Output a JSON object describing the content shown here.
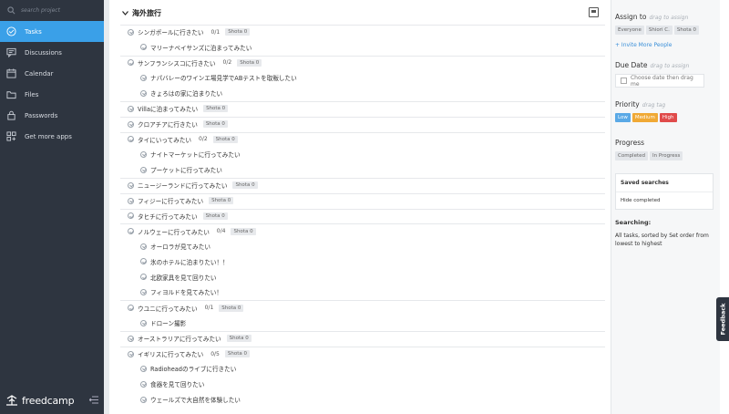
{
  "sidebar": {
    "search_placeholder": "search project",
    "items": [
      {
        "label": "Tasks",
        "icon": "check-circle-icon",
        "active": true
      },
      {
        "label": "Discussions",
        "icon": "chat-icon"
      },
      {
        "label": "Calendar",
        "icon": "calendar-icon"
      },
      {
        "label": "Files",
        "icon": "folder-icon"
      },
      {
        "label": "Passwords",
        "icon": "lock-icon"
      },
      {
        "label": "Get more apps",
        "icon": "apps-icon"
      }
    ],
    "logo": "freedcamp"
  },
  "main": {
    "list_title": "海外旅行",
    "rows": [
      {
        "text": "シンガポールに行きたい",
        "count": "0/1",
        "tag": "Shota 0",
        "level": 0
      },
      {
        "text": "マリーナベイサンズに泊まってみたい",
        "level": 1
      },
      {
        "text": "サンフランシスコに行きたい",
        "count": "0/2",
        "tag": "Shota 0",
        "level": 0
      },
      {
        "text": "ナパバレーのワインエ場見学でABテストを取販したい",
        "level": 1
      },
      {
        "text": "きょろはの家に泊まりたい",
        "level": 1
      },
      {
        "text": "Villaに泊まってみたい",
        "tag": "Shota 0",
        "level": 0
      },
      {
        "text": "クロアチアに行きたい",
        "tag": "Shota 0",
        "level": 0
      },
      {
        "text": "タイにいってみたい",
        "count": "0/2",
        "tag": "Shota 0",
        "level": 0
      },
      {
        "text": "ナイトマーケットに行ってみたい",
        "level": 1
      },
      {
        "text": "プーケットに行ってみたい",
        "level": 1
      },
      {
        "text": "ニュージーランドに行ってみたい",
        "tag": "Shota 0",
        "level": 0
      },
      {
        "text": "フィジーに行ってみたい",
        "tag": "Shota 0",
        "level": 0
      },
      {
        "text": "タヒチに行ってみたい",
        "tag": "Shota 0",
        "level": 0
      },
      {
        "text": "ノルウェーに行ってみたい",
        "count": "0/4",
        "tag": "Shota 0",
        "level": 0
      },
      {
        "text": "オーロラが見てみたい",
        "level": 1
      },
      {
        "text": "氷のホテルに泊まりたい！！",
        "level": 1
      },
      {
        "text": "北欧家具を見て回りたい",
        "level": 1
      },
      {
        "text": "フィヨルドを見てみたい！",
        "level": 1
      },
      {
        "text": "ウユニに行ってみたい",
        "count": "0/1",
        "tag": "Shota 0",
        "level": 0
      },
      {
        "text": "ドローン撮影",
        "level": 1
      },
      {
        "text": "オーストラリアに行ってみたい",
        "tag": "Shota 0",
        "level": 0
      },
      {
        "text": "イギリスに行ってみたい",
        "count": "0/5",
        "tag": "Shota 0",
        "level": 0
      },
      {
        "text": "Radioheadのライブに行きたい",
        "level": 1
      },
      {
        "text": "食器を見て回りたい",
        "level": 1
      },
      {
        "text": "ウェールズで大自然を体験したい",
        "level": 1
      }
    ]
  },
  "panel": {
    "assign_title": "Assign to",
    "assign_hint": "drag to assign",
    "assignees": [
      "Everyone",
      "Shiori C.",
      "Shota 0"
    ],
    "invite": "+ Invite More People",
    "due_title": "Due Date",
    "due_hint": "drag to assign",
    "due_box": "Choose date then drag me",
    "priority_title": "Priority",
    "priority_hint": "drag tag",
    "priorities": [
      {
        "label": "Low",
        "color": "#5aa9e6"
      },
      {
        "label": "Medium",
        "color": "#f0a935"
      },
      {
        "label": "High",
        "color": "#e04b4b"
      }
    ],
    "progress_title": "Progress",
    "progress_chips": [
      "Completed",
      "In Progress"
    ],
    "saved_title": "Saved searches",
    "saved_item": "Hide completed",
    "searching_title": "Searching:",
    "searching_desc": "All tasks, sorted by Set order from lowest to highest"
  },
  "feedback": "Feedback"
}
